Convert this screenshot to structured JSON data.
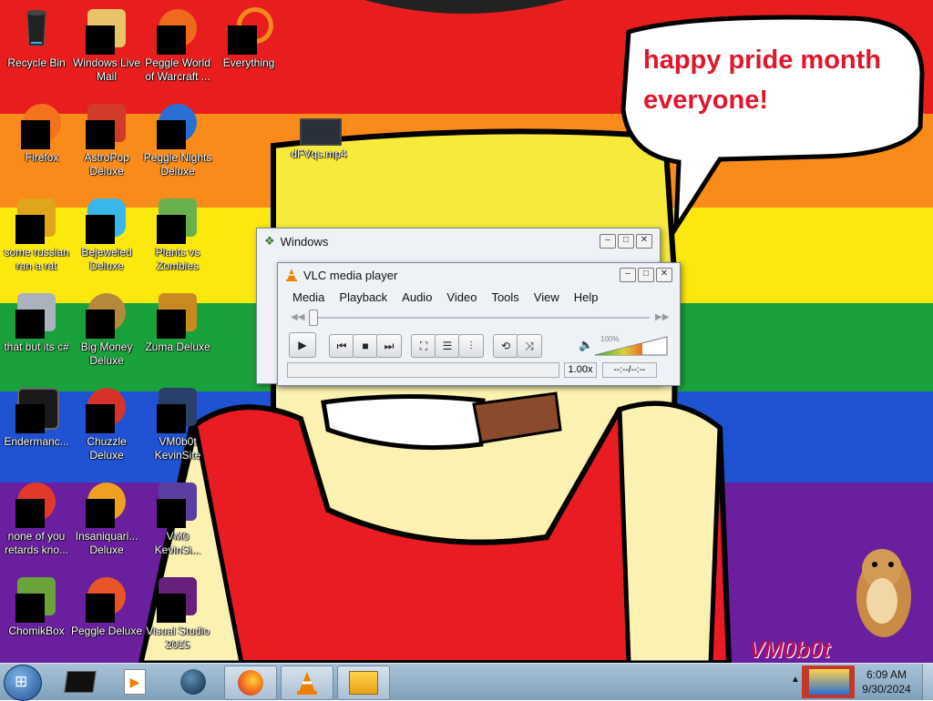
{
  "wallpaper": {
    "speech_bubble": [
      "happy pride month",
      "everyone!"
    ],
    "watermark": "VM0b0t",
    "stripe_colors": [
      "#e81e1e",
      "#f98b1b",
      "#fbe80f",
      "#19a23c",
      "#1f53d3",
      "#6a1f9e"
    ]
  },
  "desktop_icons": [
    {
      "label": "Recycle Bin",
      "icon": "recycle-bin-icon"
    },
    {
      "label": "Windows Live\nMail",
      "icon": "mail-icon"
    },
    {
      "label": "Peggle World\nof Warcraft ...",
      "icon": "peggle-icon"
    },
    {
      "label": "Everything",
      "icon": "search-icon"
    },
    {
      "label": "Firefox",
      "icon": "firefox-icon"
    },
    {
      "label": "AstroPop\nDeluxe",
      "icon": "astropop-icon"
    },
    {
      "label": "Peggle Nights\nDeluxe",
      "icon": "peggle-icon"
    },
    {
      "label": "dFVqs.mp4",
      "icon": "video-file-icon"
    },
    {
      "label": "some russian\nran a rat",
      "icon": "file-icon"
    },
    {
      "label": "Bejeweled\nDeluxe",
      "icon": "gem-icon"
    },
    {
      "label": "Plants vs\nZombies",
      "icon": "plant-icon"
    },
    {
      "label": "that but its c#",
      "icon": "file-icon"
    },
    {
      "label": "Big Money\nDeluxe",
      "icon": "money-bag-icon"
    },
    {
      "label": "Zuma Deluxe",
      "icon": "zuma-icon"
    },
    {
      "label": "Endermanc...",
      "icon": "terminal-icon"
    },
    {
      "label": "Chuzzle\nDeluxe",
      "icon": "chuzzle-icon"
    },
    {
      "label": "VM0b0t\nKevinSite",
      "icon": "shortcut-icon"
    },
    {
      "label": "none of you\nretards kno...",
      "icon": "file-icon"
    },
    {
      "label": "Insaniquari...\nDeluxe",
      "icon": "fish-icon"
    },
    {
      "label": "VM0\nKevinSi...",
      "icon": "shortcut-icon"
    },
    {
      "label": "ChomikBox",
      "icon": "hamster-icon"
    },
    {
      "label": "Peggle Deluxe",
      "icon": "peggle-icon"
    },
    {
      "label": "Visual Studio\n2015",
      "icon": "visual-studio-icon"
    }
  ],
  "windows_dialog": {
    "title": "Windows"
  },
  "vlc": {
    "title": "VLC media player",
    "menu": [
      "Media",
      "Playback",
      "Audio",
      "Video",
      "Tools",
      "View",
      "Help"
    ],
    "volume": "100%",
    "speed": "1.00x",
    "time": "--:--/--:--",
    "status": ""
  },
  "taskbar": {
    "time": "6:09 AM",
    "date": "9/30/2024",
    "items": [
      "cmd-icon",
      "media-player-icon",
      "globe-icon",
      "firefox-icon",
      "vlc-icon",
      "computer-icon"
    ]
  },
  "colors": {
    "vlc_orange": "#f08000",
    "taskbar": "#8fb0c9",
    "bubble_text": "#e0162b"
  }
}
